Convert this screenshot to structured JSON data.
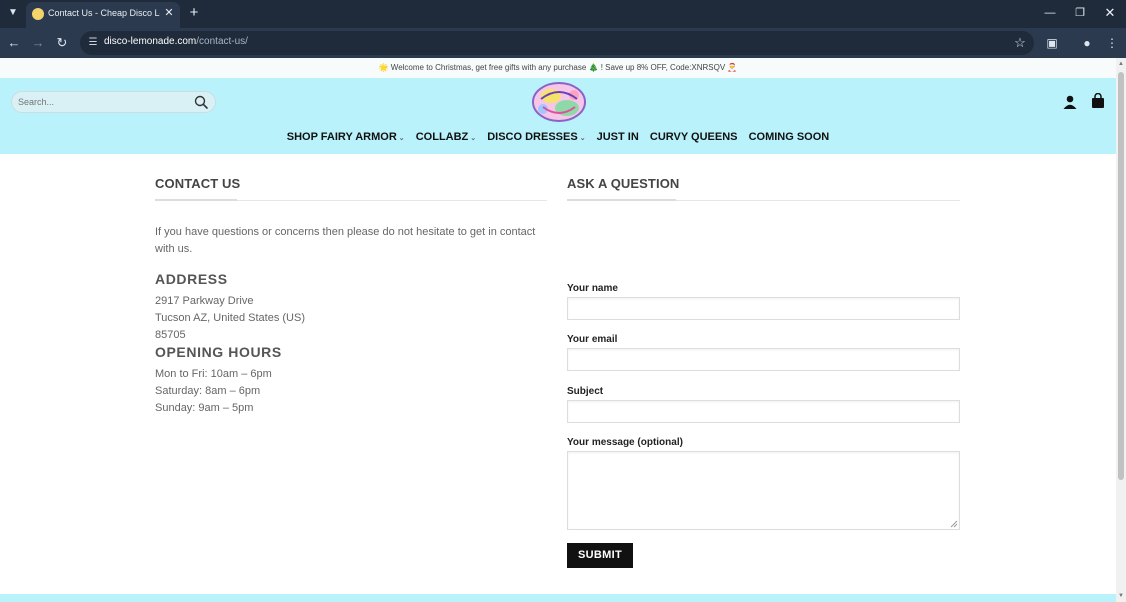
{
  "browser": {
    "tab_title": "Contact Us - Cheap Disco Lemonade",
    "url_domain": "disco-lemonade.com",
    "url_path": "/contact-us/"
  },
  "promo": {
    "text": "🌟 Welcome to Christmas, get free gifts with any purchase 🎄 ! Save up 8% OFF, Code:XNRSQV 🎅"
  },
  "header": {
    "search_placeholder": "Search...",
    "nav": [
      {
        "label": "SHOP FAIRY ARMOR",
        "has_dropdown": true
      },
      {
        "label": "COLLABZ",
        "has_dropdown": true
      },
      {
        "label": "DISCO DRESSES",
        "has_dropdown": true
      },
      {
        "label": "JUST IN",
        "has_dropdown": false
      },
      {
        "label": "CURVY QUEENS",
        "has_dropdown": false
      },
      {
        "label": "COMING SOON",
        "has_dropdown": false
      }
    ]
  },
  "contact": {
    "title": "CONTACT US",
    "intro": "If you have questions or concerns then please do not hesitate to get in contact with us.",
    "address_heading": "ADDRESS",
    "address_lines": [
      "2917 Parkway Drive",
      "Tucson AZ, United States (US)",
      "85705"
    ],
    "hours_heading": "OPENING HOURS",
    "hours_lines": [
      "Mon to Fri: 10am – 6pm",
      "Saturday: 8am – 6pm",
      "Sunday: 9am – 5pm"
    ]
  },
  "form": {
    "title": "ASK A QUESTION",
    "name_label": "Your name",
    "email_label": "Your email",
    "subject_label": "Subject",
    "message_label": "Your message (optional)",
    "name_value": "",
    "email_value": "",
    "subject_value": "",
    "message_value": "",
    "submit_label": "SUBMIT"
  },
  "colors": {
    "header_bg": "#baf2fb",
    "button_bg": "#111111",
    "browser_bg": "#1f2a3a"
  }
}
